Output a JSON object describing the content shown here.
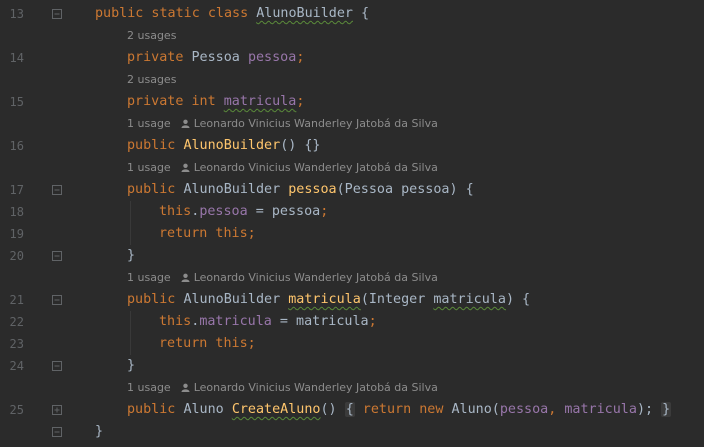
{
  "editor": {
    "lines": [
      {
        "kind": "code",
        "ln": "13",
        "fold": "open",
        "indent": 0,
        "tokens": [
          {
            "t": "public static class ",
            "c": "kw"
          },
          {
            "t": "AlunoBuilder",
            "c": "sq"
          },
          {
            "t": " {",
            "c": ""
          }
        ]
      },
      {
        "kind": "hint",
        "indent": 1,
        "usage": "2 usages",
        "author": ""
      },
      {
        "kind": "code",
        "ln": "14",
        "indent": 1,
        "tokens": [
          {
            "t": "private ",
            "c": "kw"
          },
          {
            "t": "Pessoa ",
            "c": ""
          },
          {
            "t": "pessoa",
            "c": "fld"
          },
          {
            "t": ";",
            "c": "kw"
          }
        ]
      },
      {
        "kind": "hint",
        "indent": 1,
        "usage": "2 usages",
        "author": ""
      },
      {
        "kind": "code",
        "ln": "15",
        "indent": 1,
        "tokens": [
          {
            "t": "private int ",
            "c": "kw"
          },
          {
            "t": "matricula",
            "c": "fld sq"
          },
          {
            "t": ";",
            "c": "kw"
          }
        ]
      },
      {
        "kind": "hint",
        "indent": 1,
        "usage": "1 usage",
        "author": "Leonardo Vinicius Wanderley Jatobá da Silva"
      },
      {
        "kind": "code",
        "ln": "16",
        "indent": 1,
        "tokens": [
          {
            "t": "public ",
            "c": "kw"
          },
          {
            "t": "AlunoBuilder",
            "c": "meth"
          },
          {
            "t": "() {}",
            "c": ""
          }
        ]
      },
      {
        "kind": "hint",
        "indent": 1,
        "usage": "1 usage",
        "author": "Leonardo Vinicius Wanderley Jatobá da Silva"
      },
      {
        "kind": "code",
        "ln": "17",
        "fold": "open",
        "indent": 1,
        "tokens": [
          {
            "t": "public ",
            "c": "kw"
          },
          {
            "t": "AlunoBuilder ",
            "c": ""
          },
          {
            "t": "pessoa",
            "c": "meth"
          },
          {
            "t": "(Pessoa pessoa) {",
            "c": ""
          }
        ]
      },
      {
        "kind": "code",
        "ln": "18",
        "indent": 2,
        "tokens": [
          {
            "t": "this",
            "c": "kw"
          },
          {
            "t": ".",
            "c": ""
          },
          {
            "t": "pessoa",
            "c": "fld"
          },
          {
            "t": " = pessoa",
            "c": ""
          },
          {
            "t": ";",
            "c": "kw"
          }
        ]
      },
      {
        "kind": "code",
        "ln": "19",
        "indent": 2,
        "tokens": [
          {
            "t": "return this;",
            "c": "kw"
          }
        ]
      },
      {
        "kind": "code",
        "ln": "20",
        "fold": "close",
        "indent": 1,
        "tokens": [
          {
            "t": "}",
            "c": ""
          }
        ]
      },
      {
        "kind": "hint",
        "indent": 1,
        "usage": "1 usage",
        "author": "Leonardo Vinicius Wanderley Jatobá da Silva"
      },
      {
        "kind": "code",
        "ln": "21",
        "fold": "open",
        "indent": 1,
        "tokens": [
          {
            "t": "public ",
            "c": "kw"
          },
          {
            "t": "AlunoBuilder ",
            "c": ""
          },
          {
            "t": "matricula",
            "c": "meth sq"
          },
          {
            "t": "(Integer ",
            "c": ""
          },
          {
            "t": "matricula",
            "c": "sq"
          },
          {
            "t": ") {",
            "c": ""
          }
        ]
      },
      {
        "kind": "code",
        "ln": "22",
        "indent": 2,
        "tokens": [
          {
            "t": "this",
            "c": "kw"
          },
          {
            "t": ".",
            "c": ""
          },
          {
            "t": "matricula",
            "c": "fld"
          },
          {
            "t": " = matricula",
            "c": ""
          },
          {
            "t": ";",
            "c": "kw"
          }
        ]
      },
      {
        "kind": "code",
        "ln": "23",
        "indent": 2,
        "tokens": [
          {
            "t": "return this;",
            "c": "kw"
          }
        ]
      },
      {
        "kind": "code",
        "ln": "24",
        "fold": "close",
        "indent": 1,
        "tokens": [
          {
            "t": "}",
            "c": ""
          }
        ]
      },
      {
        "kind": "hint",
        "indent": 1,
        "usage": "1 usage",
        "author": "Leonardo Vinicius Wanderley Jatobá da Silva"
      },
      {
        "kind": "code",
        "ln": "25",
        "fold": "collapsed",
        "indent": 1,
        "tokens": [
          {
            "t": "public ",
            "c": "kw"
          },
          {
            "t": "Aluno ",
            "c": ""
          },
          {
            "t": "CreateAluno",
            "c": "meth sq"
          },
          {
            "t": "() ",
            "c": ""
          },
          {
            "t": "{",
            "c": "fold-region"
          },
          {
            "t": " return new ",
            "c": "kw"
          },
          {
            "t": "Aluno(",
            "c": ""
          },
          {
            "t": "pessoa",
            "c": "fld"
          },
          {
            "t": ", ",
            "c": "kw"
          },
          {
            "t": "matricula",
            "c": "fld"
          },
          {
            "t": ");",
            "c": ""
          },
          {
            "t": " ",
            "c": ""
          },
          {
            "t": "}",
            "c": "fold-region"
          }
        ]
      },
      {
        "kind": "code",
        "ln": "",
        "fold": "close",
        "indent": 0,
        "tokens": [
          {
            "t": "}",
            "c": ""
          }
        ]
      }
    ]
  },
  "colors": {
    "background": "#2b2b2b",
    "keyword": "#cc7832",
    "field": "#9876aa",
    "method": "#ffc66d",
    "text": "#a9b7c6",
    "line_number": "#606366",
    "hint": "#8c8c8c"
  },
  "icons": {
    "fold_marker": "fold-marker-icon",
    "author": "user-icon"
  }
}
